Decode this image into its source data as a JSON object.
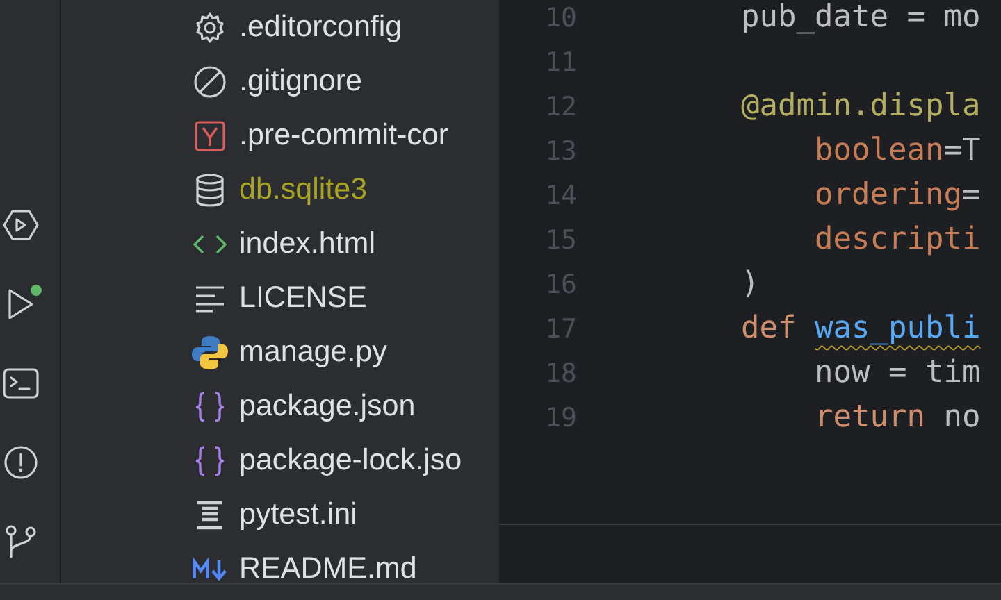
{
  "toolbar": {
    "items": [
      {
        "kind": "services",
        "badge": false
      },
      {
        "kind": "run",
        "badge": true
      },
      {
        "kind": "terminal",
        "badge": false
      },
      {
        "kind": "problems",
        "badge": false
      },
      {
        "kind": "git",
        "badge": false
      }
    ]
  },
  "file_tree": {
    "items": [
      {
        "name": ".editorconfig",
        "kind": "config",
        "ignored": false
      },
      {
        "name": ".gitignore",
        "kind": "gitignore",
        "ignored": false
      },
      {
        "name": ".pre-commit-cor",
        "kind": "yaml",
        "ignored": false
      },
      {
        "name": "db.sqlite3",
        "kind": "database",
        "ignored": true
      },
      {
        "name": "index.html",
        "kind": "html",
        "ignored": false
      },
      {
        "name": "LICENSE",
        "kind": "text",
        "ignored": false
      },
      {
        "name": "manage.py",
        "kind": "python",
        "ignored": false
      },
      {
        "name": "package.json",
        "kind": "json",
        "ignored": false
      },
      {
        "name": "package-lock.jso",
        "kind": "json",
        "ignored": false
      },
      {
        "name": "pytest.ini",
        "kind": "ini",
        "ignored": false
      },
      {
        "name": "README.md",
        "kind": "markdown",
        "ignored": false
      }
    ]
  },
  "editor": {
    "lines": [
      {
        "number": "10",
        "tokens": [
          {
            "text": "pub_date = mo",
            "kind": "plain"
          }
        ]
      },
      {
        "number": "11"
      },
      {
        "number": "12",
        "tokens": [
          {
            "text": "@admin.displa",
            "kind": "decorator"
          }
        ]
      },
      {
        "number": "13",
        "tokens": [
          {
            "text": "    boolean",
            "kind": "param"
          },
          {
            "text": "=T",
            "kind": "plain"
          }
        ]
      },
      {
        "number": "14",
        "tokens": [
          {
            "text": "    ordering",
            "kind": "param"
          },
          {
            "text": "=",
            "kind": "plain"
          }
        ]
      },
      {
        "number": "15",
        "tokens": [
          {
            "text": "    descripti",
            "kind": "param"
          }
        ]
      },
      {
        "number": "16",
        "tokens": [
          {
            "text": ")",
            "kind": "plain"
          }
        ]
      },
      {
        "number": "17",
        "tokens": [
          {
            "text": "def ",
            "kind": "keyword"
          },
          {
            "text": "was_publi",
            "kind": "function_warning"
          }
        ]
      },
      {
        "number": "18",
        "tokens": [
          {
            "text": "    now = tim",
            "kind": "plain"
          }
        ]
      },
      {
        "number": "19",
        "tokens": [
          {
            "text": "    return",
            "kind": "keyword"
          },
          {
            "text": " no",
            "kind": "plain"
          }
        ]
      }
    ]
  }
}
